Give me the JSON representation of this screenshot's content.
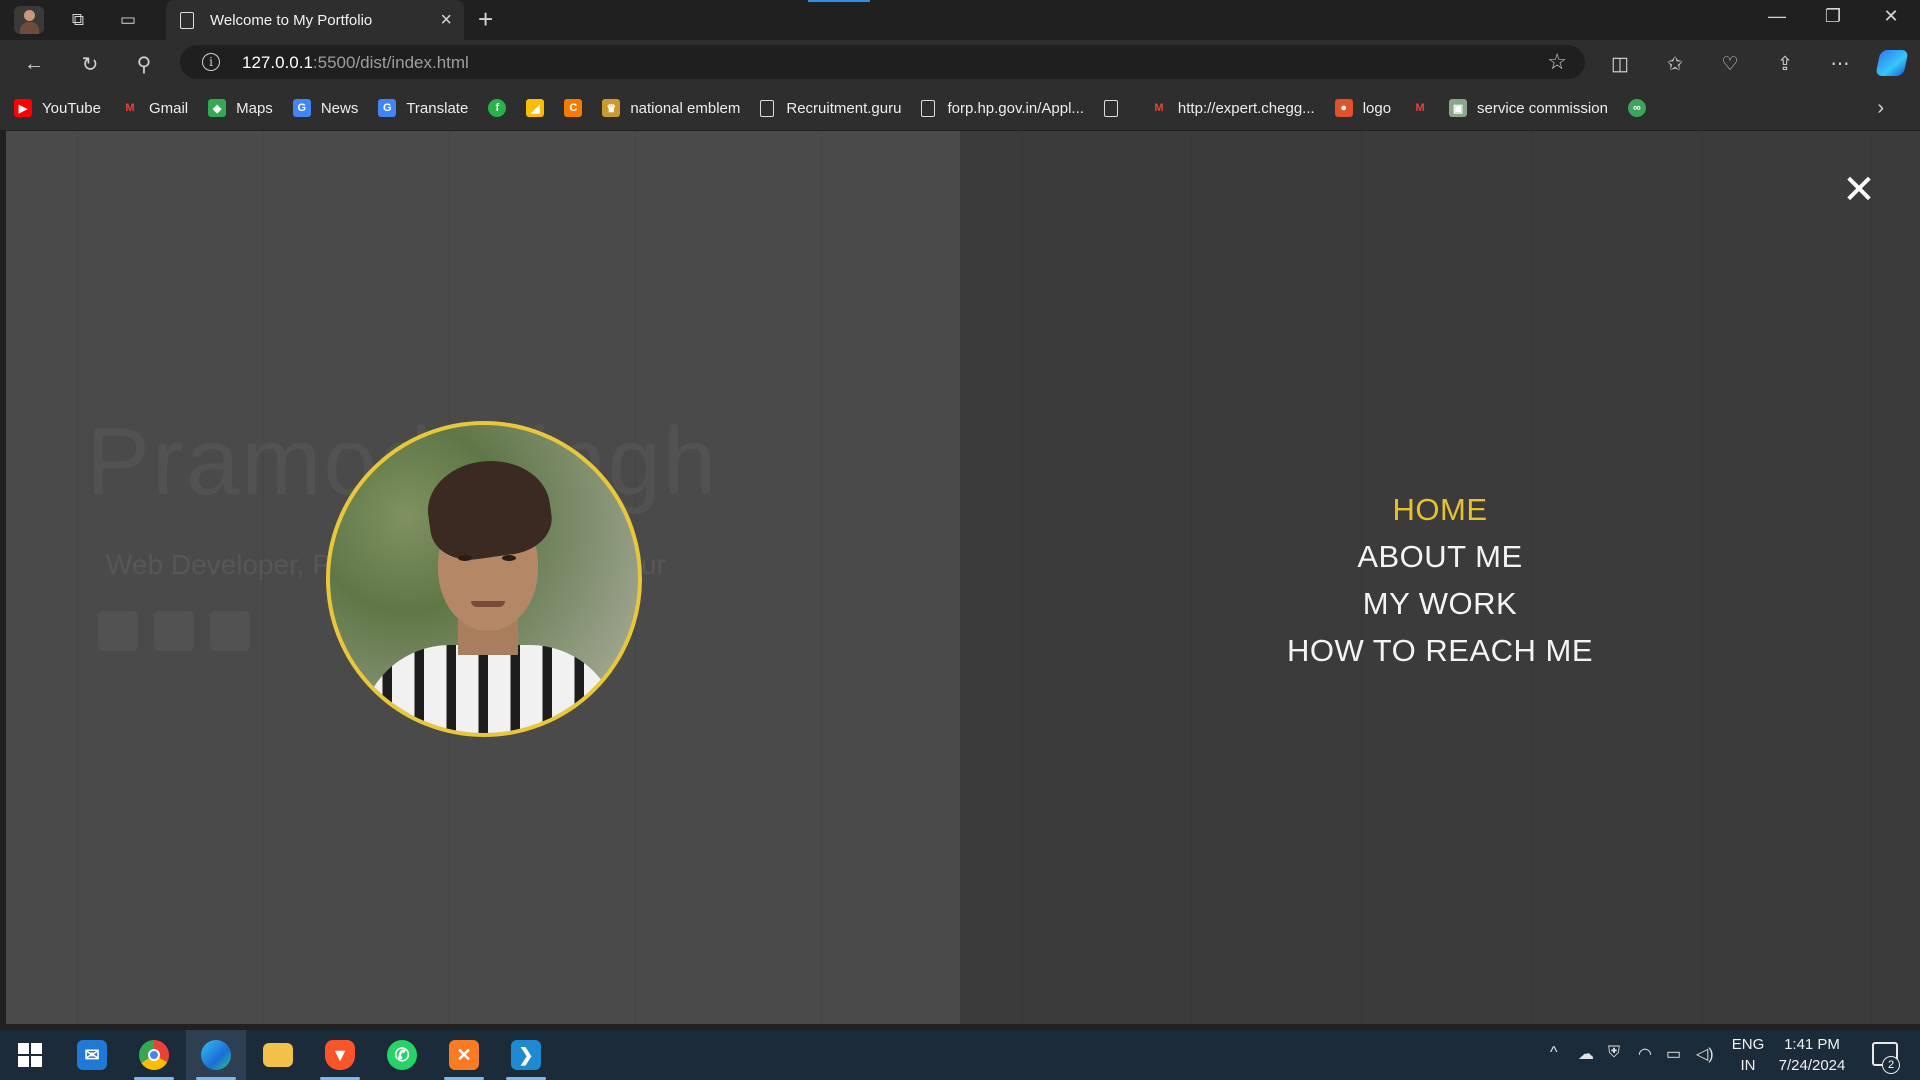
{
  "browser": {
    "tab": {
      "title": "Welcome to My Portfolio"
    },
    "address_bar": {
      "host": "127.0.0.1",
      "path": ":5500/dist/index.html"
    },
    "bookmarks": [
      {
        "label": "YouTube",
        "icon": "youtube-icon",
        "color": "#ff0000"
      },
      {
        "label": "Gmail",
        "icon": "gmail-icon",
        "color": "#ea4335"
      },
      {
        "label": "Maps",
        "icon": "maps-icon",
        "color": "#34a853"
      },
      {
        "label": "News",
        "icon": "news-icon",
        "color": "#4285f4"
      },
      {
        "label": "Translate",
        "icon": "translate-icon",
        "color": "#4285f4"
      },
      {
        "label": "",
        "icon": "f-icon",
        "color": "#2bb24c"
      },
      {
        "label": "",
        "icon": "drive-icon",
        "color": "#fbbc04"
      },
      {
        "label": "",
        "icon": "c-icon",
        "color": "#f57c00"
      },
      {
        "label": "national emblem",
        "icon": "emblem-icon",
        "color": "#c99a2e"
      },
      {
        "label": "Recruitment.guru",
        "icon": "page-icon",
        "color": "#dcdcdc"
      },
      {
        "label": "forp.hp.gov.in/Appl...",
        "icon": "page-icon",
        "color": "#dcdcdc"
      },
      {
        "label": "",
        "icon": "page-icon",
        "color": "#dcdcdc"
      },
      {
        "label": "http://expert.chegg...",
        "icon": "gmail-icon",
        "color": "#ea4335"
      },
      {
        "label": "logo",
        "icon": "logo-icon",
        "color": "#e0522b"
      },
      {
        "label": "",
        "icon": "gmail-icon",
        "color": "#ea4335"
      },
      {
        "label": "service commission",
        "icon": "image-icon",
        "color": "#8aa68a"
      },
      {
        "label": "",
        "icon": "link-icon",
        "color": "#3aa55b"
      }
    ]
  },
  "page": {
    "background_name": "Pramod Singh",
    "background_subtitle": "Web Developer, Programmer & Entrepreneur",
    "menu": [
      {
        "label": "HOME",
        "active": true
      },
      {
        "label": "ABOUT ME",
        "active": false
      },
      {
        "label": "MY WORK",
        "active": false
      },
      {
        "label": "HOW TO REACH ME",
        "active": false
      }
    ],
    "accent_color": "#e5c22e"
  },
  "taskbar": {
    "apps": [
      "start-icon",
      "mail-icon",
      "chrome-icon",
      "edge-icon",
      "file-explorer-icon",
      "brave-icon",
      "whatsapp-icon",
      "xampp-icon",
      "vscode-icon"
    ],
    "language": "ENG",
    "region": "IN",
    "time": "1:41 PM",
    "date": "7/24/2024",
    "notification_count": "2"
  }
}
